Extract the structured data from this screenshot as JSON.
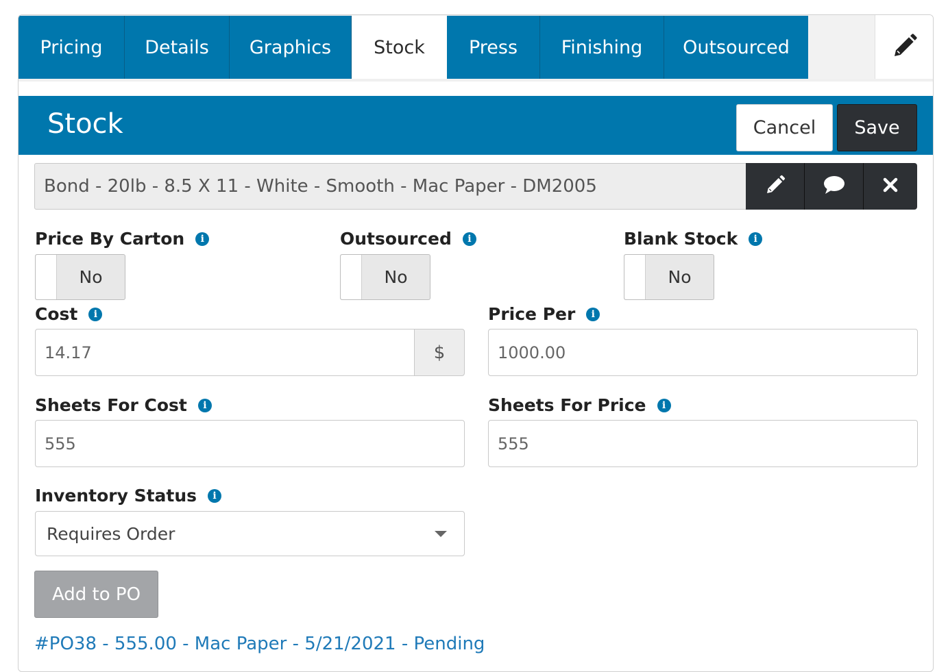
{
  "tabs": [
    {
      "label": "Pricing",
      "active": false
    },
    {
      "label": "Details",
      "active": false
    },
    {
      "label": "Graphics",
      "active": false
    },
    {
      "label": "Stock",
      "active": true
    },
    {
      "label": "Press",
      "active": false
    },
    {
      "label": "Finishing",
      "active": false
    },
    {
      "label": "Outsourced",
      "active": false
    }
  ],
  "tab_edit_icon": "pencil-icon",
  "header": {
    "title": "Stock",
    "cancel_label": "Cancel",
    "save_label": "Save"
  },
  "stock": {
    "selected": "Bond - 20lb - 8.5 X 11 - White - Smooth - Mac Paper - DM2005",
    "actions": [
      "pencil-icon",
      "comment-icon",
      "close-icon"
    ]
  },
  "toggles": {
    "price_by_carton": {
      "label": "Price By Carton",
      "value": "No"
    },
    "outsourced": {
      "label": "Outsourced",
      "value": "No"
    },
    "blank_stock": {
      "label": "Blank Stock",
      "value": "No"
    }
  },
  "fields": {
    "cost": {
      "label": "Cost",
      "value": "14.17",
      "addon": "$"
    },
    "price_per": {
      "label": "Price Per",
      "value": "1000.00"
    },
    "sheets_for_cost": {
      "label": "Sheets For Cost",
      "value": "555"
    },
    "sheets_for_price": {
      "label": "Sheets For Price",
      "value": "555"
    },
    "inventory_status": {
      "label": "Inventory Status",
      "value": "Requires Order"
    }
  },
  "add_to_po_label": "Add to PO",
  "po_link": "#PO38 - 555.00 - Mac Paper - 5/21/2021 - Pending",
  "colors": {
    "primary": "#0077ad",
    "dark_button": "#2d3034",
    "link": "#1f7ab8",
    "disabled_button": "#a3a5a8"
  }
}
